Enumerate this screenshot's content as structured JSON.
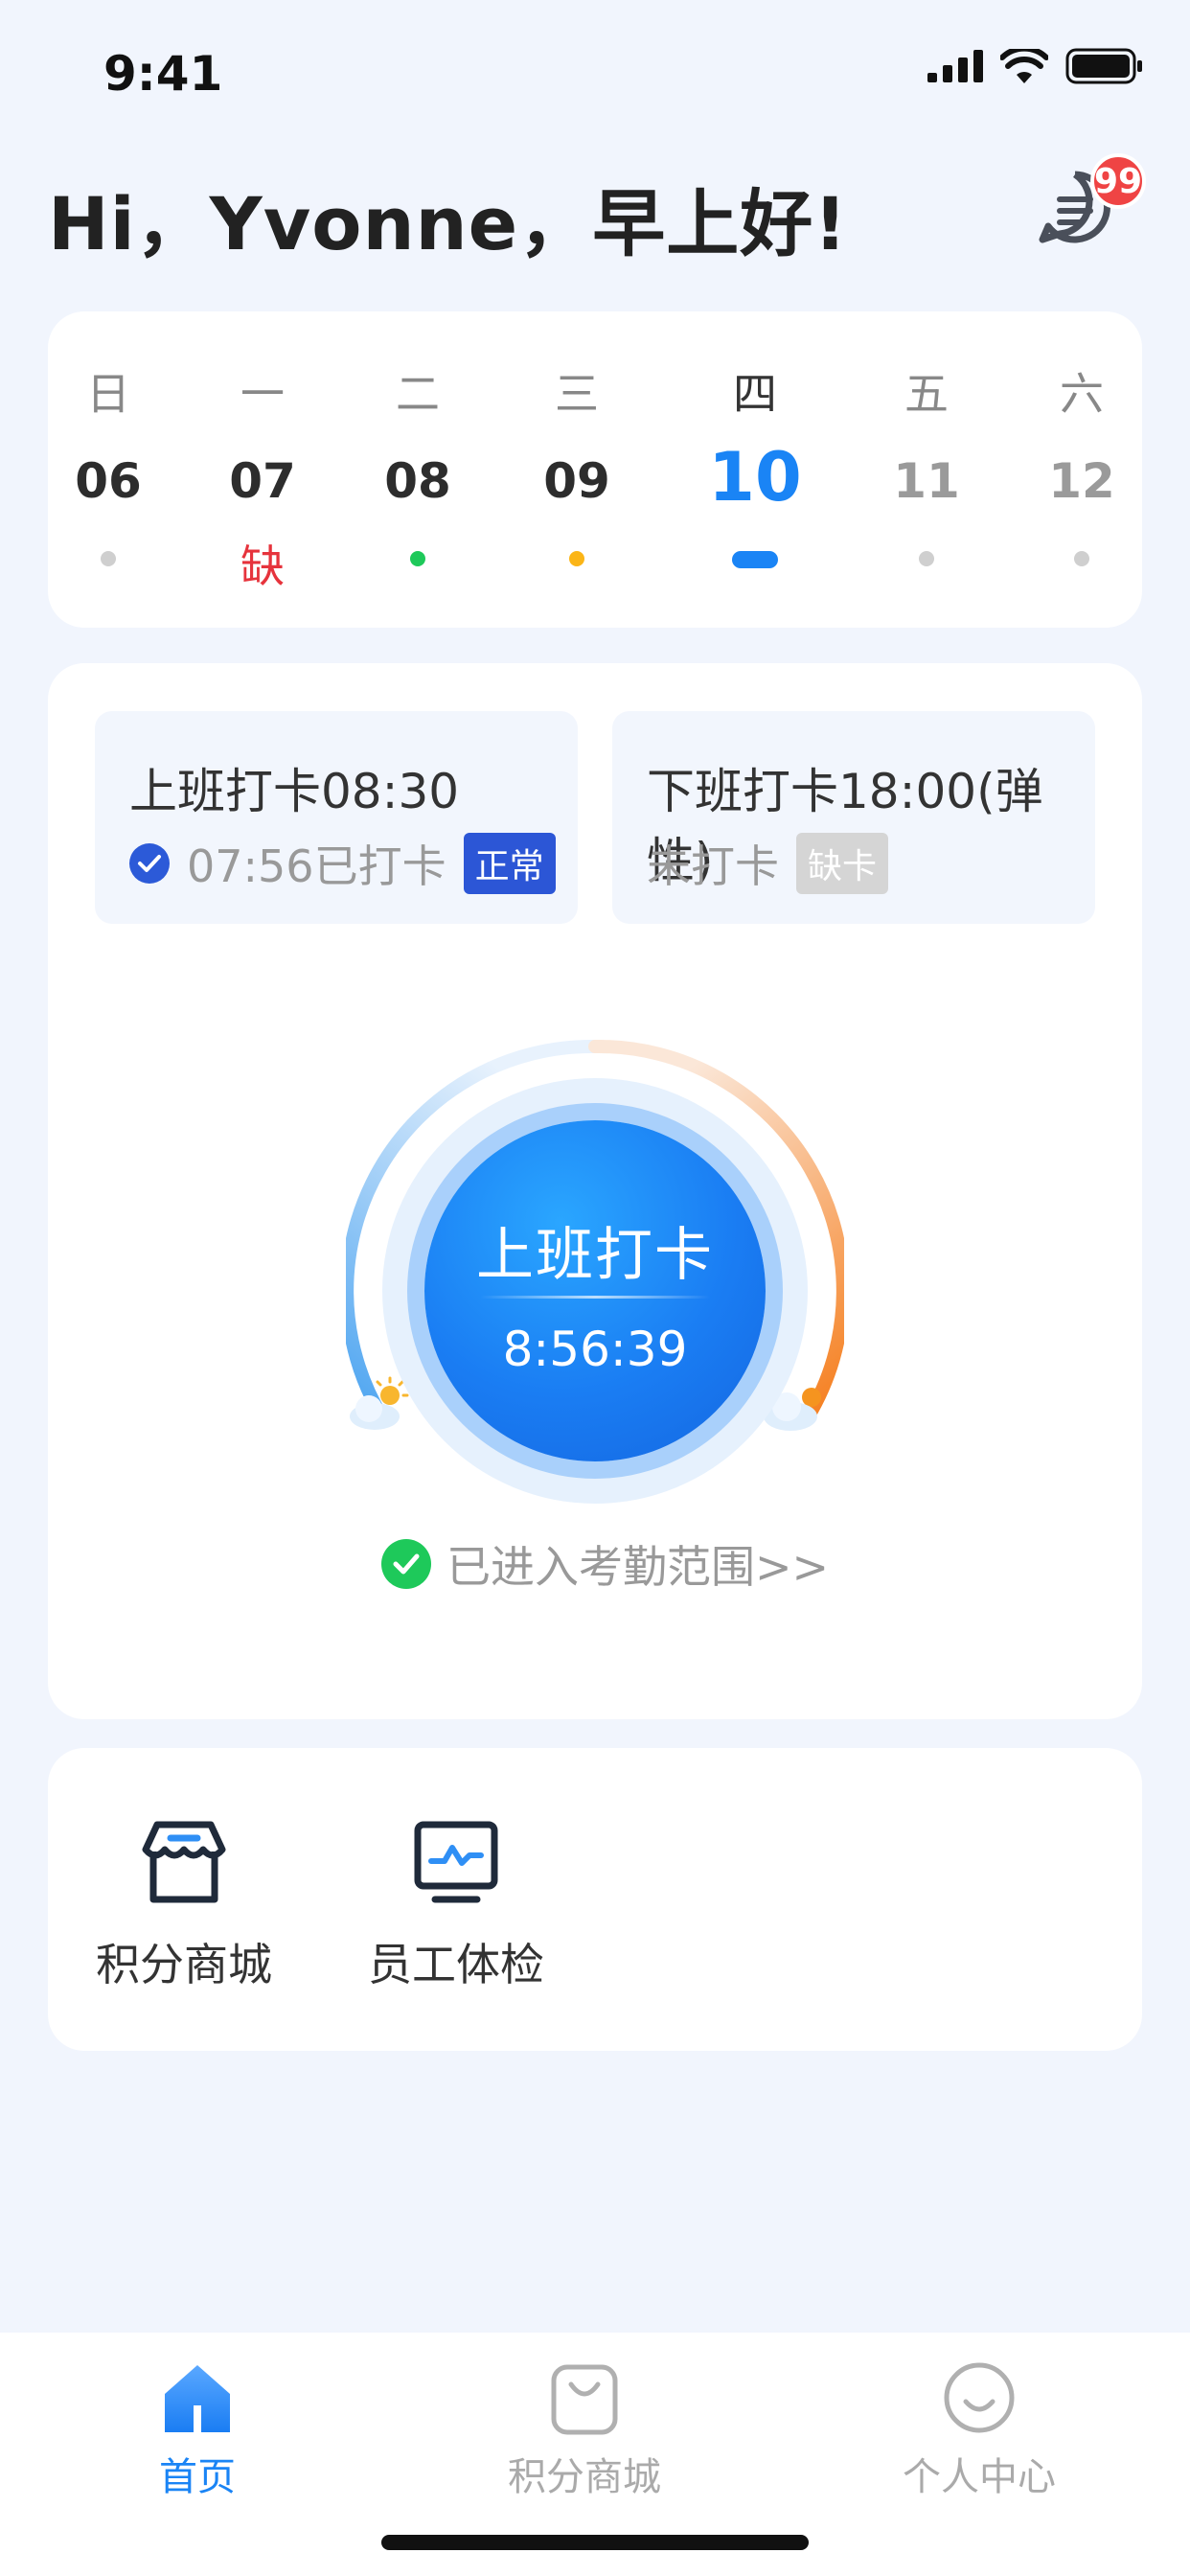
{
  "status_bar": {
    "time": "9:41"
  },
  "header": {
    "greeting": "Hi，Yvonne，早上好!",
    "message_badge": "99"
  },
  "week": {
    "days": [
      {
        "weekday": "日",
        "date": "06",
        "mark": "",
        "dot": "gray"
      },
      {
        "weekday": "一",
        "date": "07",
        "mark": "缺",
        "dot": "none"
      },
      {
        "weekday": "二",
        "date": "08",
        "mark": "",
        "dot": "green"
      },
      {
        "weekday": "三",
        "date": "09",
        "mark": "",
        "dot": "orange"
      },
      {
        "weekday": "四",
        "date": "10",
        "mark": "",
        "dot": "today"
      },
      {
        "weekday": "五",
        "date": "11",
        "mark": "",
        "dot": "gray"
      },
      {
        "weekday": "六",
        "date": "12",
        "mark": "",
        "dot": "gray"
      }
    ]
  },
  "attendance": {
    "on_duty": {
      "title": "上班打卡08:30",
      "status": "07:56已打卡",
      "tag": "正常"
    },
    "off_duty": {
      "title": "下班打卡18:00(弹性)",
      "status": "未打卡",
      "tag": "缺卡"
    },
    "clock_button": {
      "label": "上班打卡",
      "time": "8:56:39"
    },
    "range_text": "已进入考勤范围>>"
  },
  "quick_entries": [
    {
      "label": "积分商城",
      "icon": "store-icon"
    },
    {
      "label": "员工体检",
      "icon": "monitor-health-icon"
    }
  ],
  "tabbar": {
    "tabs": [
      {
        "label": "首页",
        "icon": "home-icon",
        "active": true
      },
      {
        "label": "积分商城",
        "icon": "shopping-bag-icon",
        "active": false
      },
      {
        "label": "个人中心",
        "icon": "smile-user-icon",
        "active": false
      }
    ]
  },
  "colors": {
    "accent": "#1a84f5",
    "normal_tag": "#2c56d6",
    "missing": "#e6333c",
    "success": "#1ec95a"
  }
}
